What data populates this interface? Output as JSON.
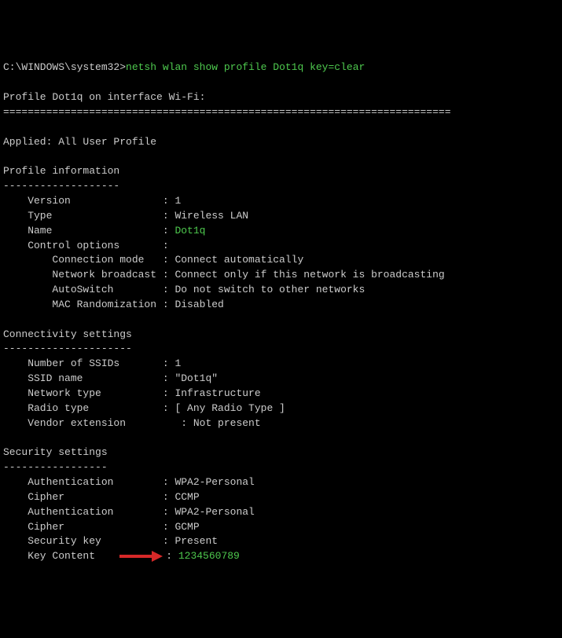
{
  "prompt": {
    "path": "C:\\WINDOWS\\system32>",
    "cmd_prefix": "netsh wlan show profile ",
    "cmd_arg": "Dot1q",
    "cmd_key_label": " key=",
    "cmd_key_value": "clear"
  },
  "header": {
    "title": "Profile Dot1q on interface Wi-Fi:",
    "rule": "========================================================================="
  },
  "applied": {
    "text": "Applied: All User Profile"
  },
  "profile_info": {
    "heading": "Profile information",
    "dashes": "-------------------",
    "version": {
      "label": "    Version               : ",
      "value": "1"
    },
    "type": {
      "label": "    Type                  : ",
      "value": "Wireless LAN"
    },
    "name": {
      "label": "    Name                  : ",
      "value": "Dot1q"
    },
    "control_opts": "    Control options       :",
    "conn_mode": {
      "label": "        Connection mode   : ",
      "value": "Connect automatically"
    },
    "net_bcast": {
      "label": "        Network broadcast : ",
      "value": "Connect only if this network is broadcasting"
    },
    "autoswitch": {
      "label": "        AutoSwitch        : ",
      "value": "Do not switch to other networks"
    },
    "mac_rand": {
      "label": "        MAC Randomization : ",
      "value": "Disabled"
    }
  },
  "connectivity": {
    "heading": "Connectivity settings",
    "dashes": "---------------------",
    "num_ssids": {
      "label": "    Number of SSIDs       : ",
      "value": "1"
    },
    "ssid_name": {
      "label": "    SSID name             : ",
      "value": "\"Dot1q\""
    },
    "net_type": {
      "label": "    Network type          : ",
      "value": "Infrastructure"
    },
    "radio_type": {
      "label": "    Radio type            : ",
      "value": "[ Any Radio Type ]"
    },
    "vendor_ext": {
      "label": "    Vendor extension         : ",
      "value": "Not present"
    }
  },
  "security": {
    "heading": "Security settings",
    "dashes": "-----------------",
    "auth1": {
      "label": "    Authentication        : ",
      "value": "WPA2-Personal"
    },
    "cipher1": {
      "label": "    Cipher                : ",
      "value": "CCMP"
    },
    "auth2": {
      "label": "    Authentication        : ",
      "value": "WPA2-Personal"
    },
    "cipher2": {
      "label": "    Cipher                : ",
      "value": "GCMP"
    },
    "seckey": {
      "label": "    Security key          : ",
      "value": "Present"
    },
    "keycontent": {
      "label": "    Key Content    ",
      "colon": ": ",
      "value": "1234560789"
    }
  }
}
